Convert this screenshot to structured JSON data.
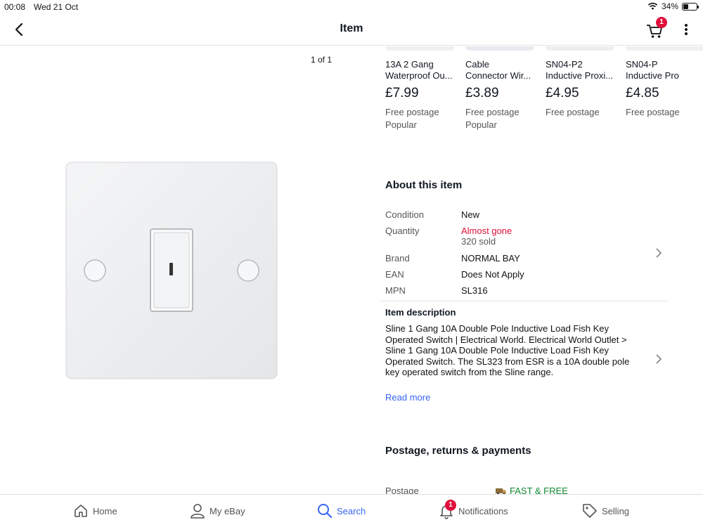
{
  "status": {
    "time": "00:08",
    "date": "Wed 21 Oct",
    "battery": "34%"
  },
  "header": {
    "title": "Item",
    "cart_count": "1"
  },
  "gallery": {
    "counter": "1 of 1",
    "image_icon": "key-switch-icon"
  },
  "related": [
    {
      "title": "13A 2 Gang Waterproof Ou...",
      "line1": "13A 2 Gang",
      "line2": "Waterproof Ou...",
      "price": "£7.99",
      "shipping": "Free postage",
      "tag": "Popular"
    },
    {
      "title": "Cable Connector Wir...",
      "line1": "Cable",
      "line2": "Connector Wir...",
      "price": "£3.89",
      "shipping": "Free postage",
      "tag": "Popular"
    },
    {
      "title": "SN04-P2 Inductive Proxi...",
      "line1": "SN04-P2",
      "line2": "Inductive Proxi...",
      "price": "£4.95",
      "shipping": "Free postage",
      "tag": ""
    },
    {
      "title": "SN04-P Inductive Pr",
      "line1": "SN04-P",
      "line2": "Inductive Pro",
      "price": "£4.85",
      "shipping": "Free postage",
      "tag": ""
    }
  ],
  "about": {
    "heading": "About this item",
    "condition_label": "Condition",
    "condition_value": "New",
    "quantity_label": "Quantity",
    "quantity_value": "Almost gone",
    "sold": "320 sold",
    "brand_label": "Brand",
    "brand_value": "NORMAL BAY",
    "ean_label": "EAN",
    "ean_value": "Does Not Apply",
    "mpn_label": "MPN",
    "mpn_value": "SL316"
  },
  "description": {
    "heading": "Item description",
    "text": "Sline 1 Gang 10A Double Pole Inductive Load Fish Key Operated Switch | Electrical World. Electrical World Outlet > Sline 1 Gang 10A Double Pole Inductive Load Fish Key Operated Switch. The SL323 from ESR is a 10A double pole key operated switch from the Sline range.",
    "read_more": "Read more"
  },
  "postage": {
    "heading": "Postage, returns & payments",
    "label": "Postage",
    "value": "FAST & FREE"
  },
  "tabs": {
    "home": "Home",
    "my_ebay": "My eBay",
    "search": "Search",
    "notifications": "Notifications",
    "notifications_count": "1",
    "selling": "Selling"
  },
  "colors": {
    "accent": "#3665f3",
    "alert": "#e0103a",
    "success": "#118a31"
  }
}
